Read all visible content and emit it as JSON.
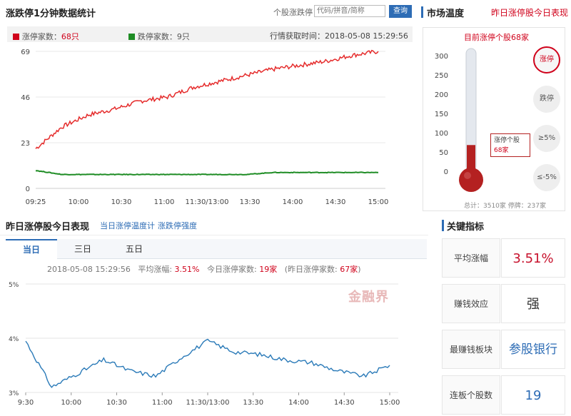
{
  "minute_panel": {
    "title": "涨跌停1分钟数据统计",
    "search_label": "个股涨跌停",
    "search_placeholder": "代码/拼音/简称",
    "query_button": "查询",
    "legend_up_label": "涨停家数：",
    "legend_up_value": "68只",
    "legend_down_label": "跌停家数：",
    "legend_down_value": "9只",
    "fetch_time": "行情获取时间：2018-05-08 15:29:56"
  },
  "market_temp": {
    "title": "市场温度",
    "link": "昨日涨停股今日表现",
    "subtitle": "目前涨停个股68家",
    "scale": [
      "300",
      "250",
      "200",
      "150",
      "100",
      "50",
      "0"
    ],
    "tip_line1": "涨停个股",
    "tip_line2": "68家",
    "buttons": {
      "up": "涨停",
      "down": "跌停",
      "gt5": "≥5%",
      "lt5": "≤-5%"
    },
    "footer": "总计：3510家 停牌：237家",
    "thermo_value": 68,
    "colors": {
      "red": "#b42121",
      "glass": "#dfe4ea"
    }
  },
  "yesterday_panel": {
    "title": "昨日涨停股今日表现",
    "link1": "当日涨停温度计",
    "link2": "涨跌停强度",
    "tabs": [
      "当日",
      "三日",
      "五日"
    ],
    "info_time": "2018-05-08 15:29:56",
    "info_avg_label": "平均涨幅:",
    "info_avg_value": "3.51%",
    "info_today_label": "今日涨停家数:",
    "info_today_value": "19家",
    "info_prev_label": "(昨日涨停家数:",
    "info_prev_value": "67家",
    "info_prev_close": ")",
    "watermark": "金融界"
  },
  "key_metrics": {
    "title": "关键指标",
    "rows": [
      {
        "label": "平均涨幅",
        "value": "3.51%"
      },
      {
        "label": "赚钱效应",
        "value": "强"
      },
      {
        "label": "最赚钱板块",
        "value": "参股银行"
      },
      {
        "label": "连板个股数",
        "value": "19"
      }
    ]
  },
  "chart_data": [
    {
      "type": "line",
      "title": "",
      "xlabel": "",
      "ylabel": "",
      "x": [
        "09:25",
        "10:00",
        "10:30",
        "11:00",
        "11:30/13:00",
        "13:30",
        "14:00",
        "14:30",
        "15:00"
      ],
      "yticks": [
        0,
        23,
        46,
        69
      ],
      "ylim": [
        0,
        69
      ],
      "series": [
        {
          "name": "涨停家数",
          "color": "#e52c2c",
          "values": [
            20,
            31,
            37,
            40,
            44,
            46,
            51,
            54,
            57,
            60,
            62,
            64,
            67,
            69
          ]
        },
        {
          "name": "跌停家数",
          "color": "#1e8c24",
          "values": [
            9,
            7,
            7,
            7,
            7,
            7,
            7,
            7,
            7,
            8,
            8,
            8,
            8,
            8
          ]
        }
      ]
    },
    {
      "type": "line",
      "title": "",
      "xlabel": "",
      "ylabel": "",
      "x": [
        "9:30",
        "10:00",
        "10:30",
        "11:00",
        "11:30/13:00",
        "13:30",
        "14:00",
        "14:30",
        "15:00"
      ],
      "yticks": [
        "3%",
        "4%",
        "5%"
      ],
      "ylim": [
        3,
        5
      ],
      "series": [
        {
          "name": "平均涨幅",
          "color": "#2a7ab8",
          "values": [
            3.95,
            3.1,
            3.35,
            3.6,
            3.4,
            3.3,
            3.65,
            3.95,
            3.75,
            3.7,
            3.6,
            3.55,
            3.4,
            3.3,
            3.5
          ]
        }
      ]
    }
  ]
}
